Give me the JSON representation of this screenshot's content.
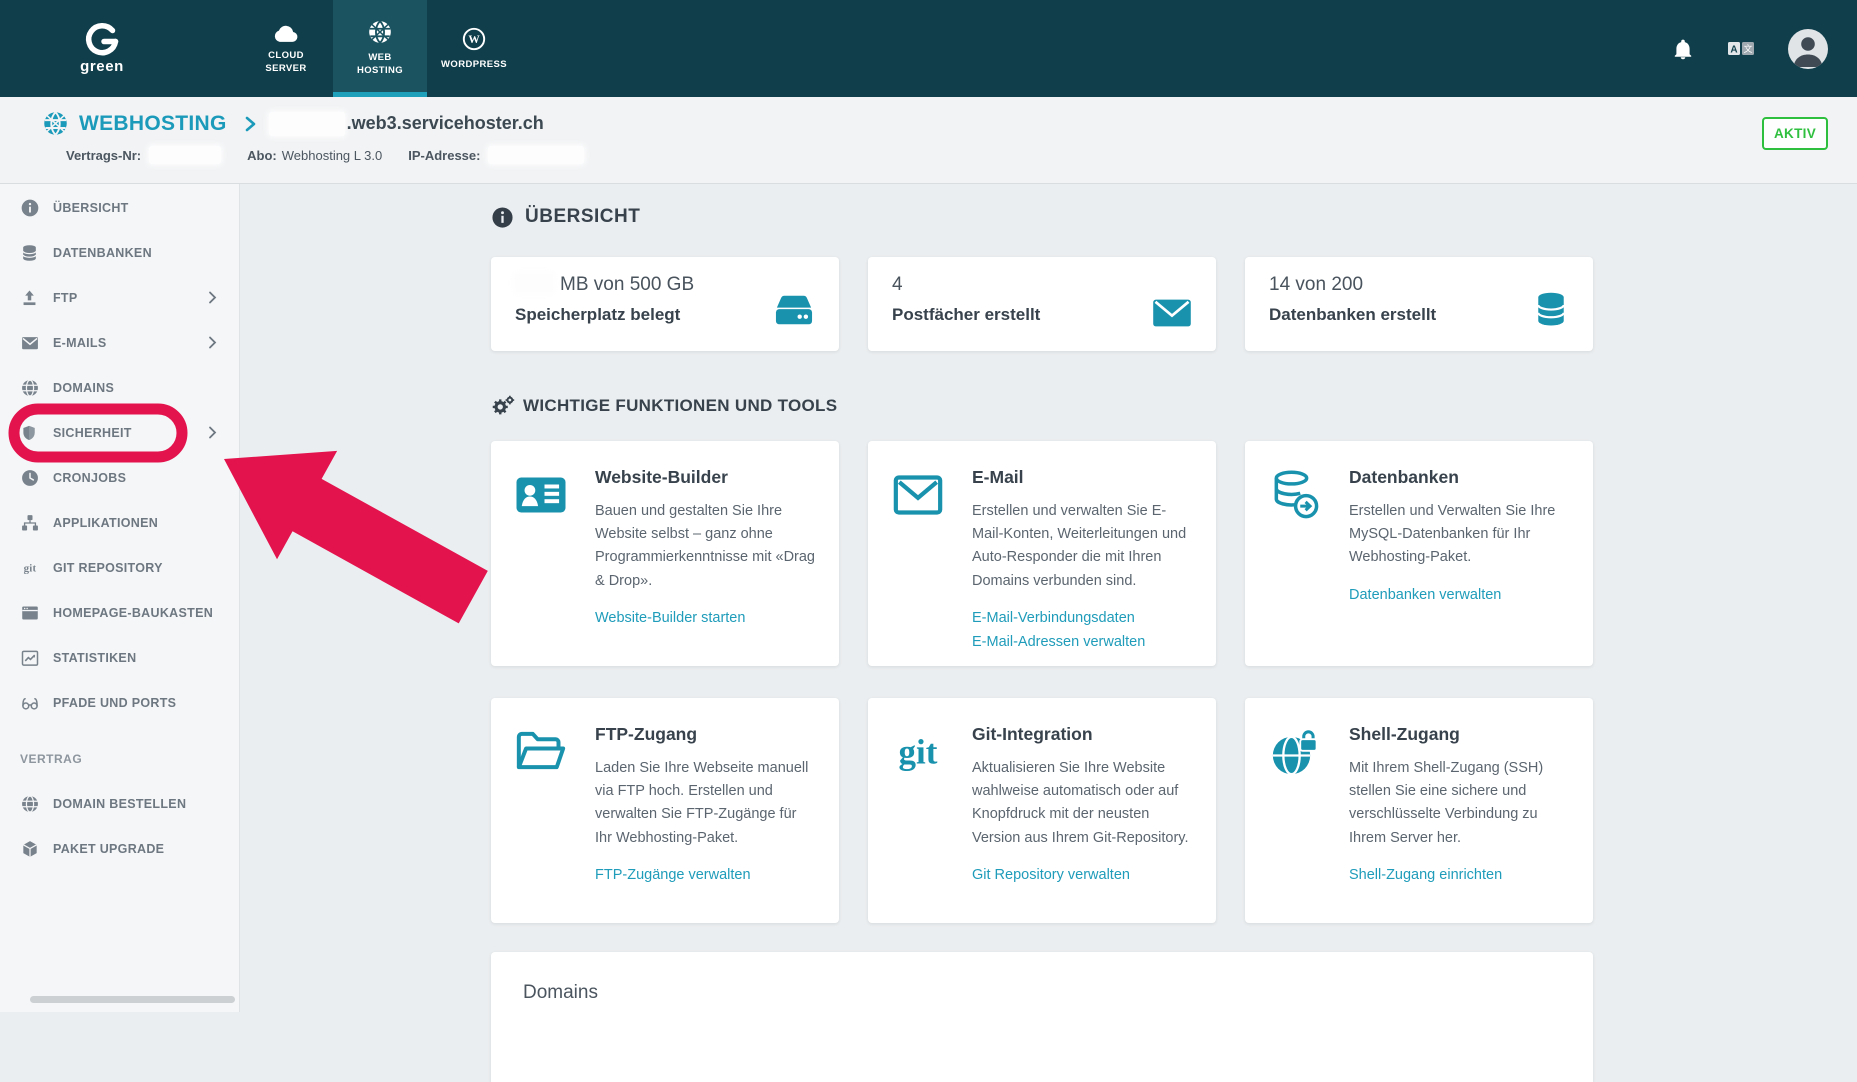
{
  "topnav": {
    "brand": "green",
    "tabs": [
      {
        "label": "CLOUD SERVER",
        "icon": "cloud-icon",
        "active": false
      },
      {
        "label": "WEB HOSTING",
        "icon": "webhosting-icon",
        "active": true
      },
      {
        "label": "WORDPRESS",
        "icon": "wordpress-icon",
        "active": false
      }
    ],
    "action_icons": [
      "notifications-icon",
      "translate-icon",
      "account-icon"
    ]
  },
  "header": {
    "breadcrumb_root": "WEBHOSTING",
    "domain_suffix": ".web3.servicehoster.ch",
    "meta": [
      {
        "label": "Vertrags-Nr:",
        "value": "",
        "redacted": true
      },
      {
        "label": "Abo:",
        "value": "Webhosting L 3.0",
        "redacted": false
      },
      {
        "label": "IP-Adresse:",
        "value": "",
        "redacted": true
      }
    ],
    "status_badge": "AKTIV"
  },
  "sidebar": {
    "items": [
      {
        "label": "ÜBERSICHT",
        "icon": "info-icon",
        "has_children": false
      },
      {
        "label": "DATENBANKEN",
        "icon": "database-icon",
        "has_children": false
      },
      {
        "label": "FTP",
        "icon": "upload-icon",
        "has_children": true
      },
      {
        "label": "E-MAILS",
        "icon": "envelope-icon",
        "has_children": true
      },
      {
        "label": "DOMAINS",
        "icon": "globe-icon",
        "has_children": false
      },
      {
        "label": "SICHERHEIT",
        "icon": "shield-icon",
        "has_children": true,
        "annotated": true
      },
      {
        "label": "CRONJOBS",
        "icon": "clock-icon",
        "has_children": false
      },
      {
        "label": "APPLIKATIONEN",
        "icon": "apps-icon",
        "has_children": false
      },
      {
        "label": "GIT REPOSITORY",
        "icon": "git-icon",
        "has_children": false
      },
      {
        "label": "HOMEPAGE-BAUKASTEN",
        "icon": "window-icon",
        "has_children": false
      },
      {
        "label": "STATISTIKEN",
        "icon": "chart-icon",
        "has_children": false
      },
      {
        "label": "PFADE UND PORTS",
        "icon": "glasses-icon",
        "has_children": false
      }
    ],
    "section_label": "VERTRAG",
    "contract_items": [
      {
        "label": "DOMAIN BESTELLEN",
        "icon": "globe-icon"
      },
      {
        "label": "PAKET UPGRADE",
        "icon": "package-icon"
      }
    ]
  },
  "main": {
    "title": "ÜBERSICHT",
    "stats": [
      {
        "value": "MB von 500 GB",
        "value_redacted_prefix": true,
        "label": "Speicherplatz belegt",
        "icon": "harddisk-icon"
      },
      {
        "value": "4",
        "value_redacted_prefix": false,
        "label": "Postfächer erstellt",
        "icon": "mail-icon"
      },
      {
        "value": "14 von 200",
        "value_redacted_prefix": false,
        "label": "Datenbanken erstellt",
        "icon": "database-stack-icon"
      }
    ],
    "tools_title": "WICHTIGE FUNKTIONEN UND TOOLS",
    "tools": [
      {
        "title": "Website-Builder",
        "icon": "idcard-icon",
        "description": "Bauen und gestalten Sie Ihre Website selbst – ganz ohne Programmierkenntnisse mit «Drag & Drop».",
        "links": [
          "Website-Builder starten"
        ]
      },
      {
        "title": "E-Mail",
        "icon": "envelope-icon",
        "description": "Erstellen und verwalten Sie E-Mail-Konten, Weiterleitungen und Auto-Responder die mit Ihren Domains verbunden sind.",
        "links": [
          "E-Mail-Verbindungsdaten",
          "E-Mail-Adressen verwalten"
        ]
      },
      {
        "title": "Datenbanken",
        "icon": "database-arrow-icon",
        "description": "Erstellen und Verwalten Sie Ihre MySQL-Datenbanken für Ihr Webhosting-Paket.",
        "links": [
          "Datenbanken verwalten"
        ]
      },
      {
        "title": "FTP-Zugang",
        "icon": "folder-icon",
        "description": "Laden Sie Ihre Webseite manuell via FTP hoch. Erstellen und verwalten Sie FTP-Zugänge für Ihr Webhosting-Paket.",
        "links": [
          "FTP-Zugänge verwalten"
        ]
      },
      {
        "title": "Git-Integration",
        "icon": "git-icon",
        "description": "Aktualisieren Sie Ihre Website wahlweise automatisch oder auf Knopfdruck mit der neusten Version aus Ihrem Git-Repository.",
        "links": [
          "Git Repository verwalten"
        ]
      },
      {
        "title": "Shell-Zugang",
        "icon": "globe-lock-icon",
        "description": "Mit Ihrem Shell-Zugang (SSH) stellen Sie eine sichere und verschlüsselte Verbindung zu Ihrem Server her.",
        "links": [
          "Shell-Zugang einrichten"
        ]
      }
    ],
    "domains_title": "Domains"
  },
  "colors": {
    "nav_background": "#103f4b",
    "accent_teal": "#1992ae",
    "link_teal": "#1f9cba",
    "status_green": "#2fbf3f",
    "annotation_red": "#e3134e"
  }
}
